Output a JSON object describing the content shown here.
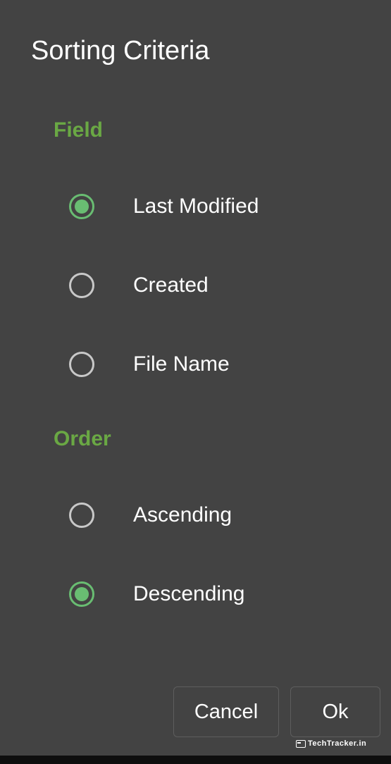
{
  "dialog": {
    "title": "Sorting Criteria"
  },
  "field_section": {
    "heading": "Field",
    "options": [
      {
        "label": "Last Modified",
        "selected": true
      },
      {
        "label": "Created",
        "selected": false
      },
      {
        "label": "File Name",
        "selected": false
      }
    ]
  },
  "order_section": {
    "heading": "Order",
    "options": [
      {
        "label": "Ascending",
        "selected": false
      },
      {
        "label": "Descending",
        "selected": true
      }
    ]
  },
  "buttons": {
    "cancel_label": "Cancel",
    "ok_label": "Ok"
  },
  "watermark": {
    "text": "TechTracker.in"
  },
  "colors": {
    "dialog_background": "#434343",
    "accent_green": "#69bd72",
    "heading_green": "#6aa844",
    "radio_unchecked": "#c8c8c8",
    "text": "#ffffff"
  },
  "icons": {
    "watermark": "monitor-icon"
  }
}
